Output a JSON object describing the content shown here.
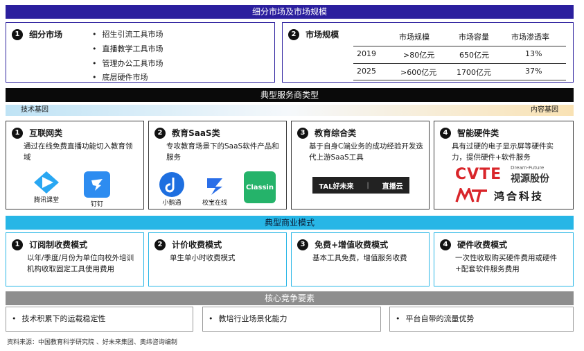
{
  "header_bar": "细分市场及市场规模",
  "segments": {
    "num": "1",
    "title": "细分市场",
    "items": [
      "招生引流工具市场",
      "直播教学工具市场",
      "管理办公工具市场",
      "底层硬件市场"
    ]
  },
  "market": {
    "num": "2",
    "title": "市场规模",
    "columns": [
      "市场规模",
      "市场容量",
      "市场渗透率"
    ],
    "rows": [
      {
        "year": "2019",
        "size": ">80亿元",
        "capacity": "650亿元",
        "rate": "13%"
      },
      {
        "year": "2025",
        "size": ">600亿元",
        "capacity": "1700亿元",
        "rate": "37%"
      }
    ]
  },
  "provider_bar": "典型服务商类型",
  "gene": {
    "left": "技术基因",
    "right": "内容基因"
  },
  "providers": [
    {
      "num": "1",
      "title": "互联网类",
      "desc": "通过在线免费直播功能切入教育领域",
      "logos": [
        "腾讯课堂",
        "钉钉"
      ]
    },
    {
      "num": "2",
      "title": "教育SaaS类",
      "desc": "专攻教育场景下的SaaS软件产品和服务",
      "logos": [
        "小鹅通",
        "校宝在线",
        "Classin"
      ]
    },
    {
      "num": "3",
      "title": "教育综合类",
      "desc": "基于自身C端业务的成功经验开发迭代上游SaaS工具",
      "logos": [
        "TAL好未来",
        "直播云"
      ]
    },
    {
      "num": "4",
      "title": "智能硬件类",
      "desc": "具有过硬的电子显示屏等硬件实力，提供硬件+软件服务",
      "logos": [
        "CVTE",
        "Dream-Future",
        "视源股份",
        "鸿合科技"
      ]
    }
  ],
  "business_bar": "典型商业模式",
  "models": [
    {
      "num": "1",
      "title": "订阅制收费模式",
      "desc": "以年/季度/月份为单位向校外培训机构收取固定工具使用费用"
    },
    {
      "num": "2",
      "title": "计价收费模式",
      "desc": "单生单小时收费模式"
    },
    {
      "num": "3",
      "title": "免费+增值收费模式",
      "desc": "基本工具免费，增值服务收费"
    },
    {
      "num": "4",
      "title": "硬件收费模式",
      "desc": "一次性收取购买硬件费用或硬件+配套软件服务费用"
    }
  ],
  "core_bar": "核心竞争要素",
  "core": [
    "技术积累下的运载稳定性",
    "教培行业场景化能力",
    "平台自带的流量优势"
  ],
  "source": "资料来源：中国教育科学研究院 、好未来集团、奥纬咨询编制",
  "colors": {
    "purple": "#2b1f9e",
    "black": "#0a0a0a",
    "cyan": "#27b6e6",
    "gray": "#8e8e8e"
  }
}
